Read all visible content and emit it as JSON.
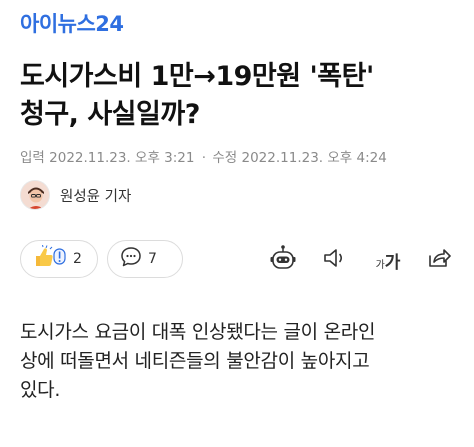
{
  "logo": {
    "text": "아이뉴스24"
  },
  "article": {
    "headline_line1": "도시가스비 1만→19만원 '폭탄'",
    "headline_line2": "청구, 사실일까?",
    "input_label": "입력",
    "input_time": "2022.11.23. 오후 3:21",
    "separator": "·",
    "modified_label": "수정",
    "modified_time": "2022.11.23. 오후 4:24",
    "reporter": "원성윤 기자",
    "body_line1": "도시가스 요금이 대폭 인상됐다는 글이 온라인",
    "body_line2": "상에 떠돌면서 네티즌들의 불안감이 높아지고",
    "body_line3": "있다."
  },
  "actions": {
    "reaction_count": "2",
    "comment_count": "7",
    "font_small": "가",
    "font_large": "가"
  },
  "icons": {
    "reaction": "thumbs-up-icon",
    "comment": "speech-bubble-icon",
    "summary": "robot-icon",
    "tts": "speaker-icon",
    "share": "share-icon"
  },
  "colors": {
    "brand": "#2f6fe0",
    "meta": "#8a8a8a",
    "border": "#dcdcdc"
  }
}
